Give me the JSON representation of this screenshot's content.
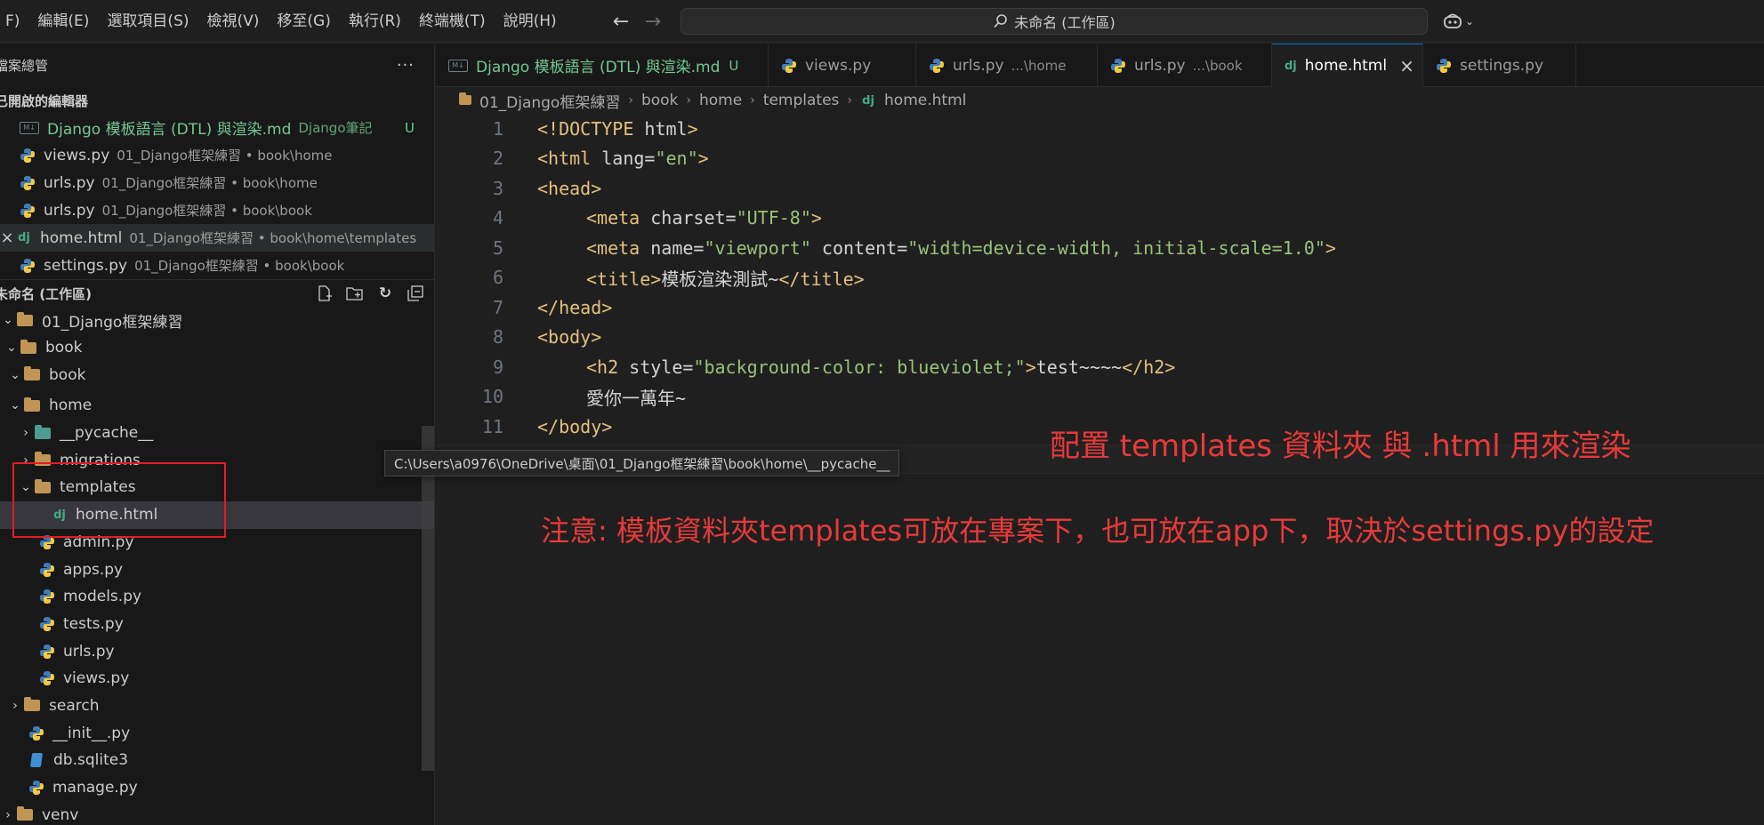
{
  "menu": {
    "items": [
      "F)",
      "編輯(E)",
      "選取項目(S)",
      "檢視(V)",
      "移至(G)",
      "執行(R)",
      "終端機(T)",
      "說明(H)"
    ]
  },
  "command_center": {
    "text": "未命名 (工作區)"
  },
  "sidebar": {
    "title": "檔案總管",
    "more_label": "···",
    "open_editors_title": "已開啟的編輯器",
    "open_editors": [
      {
        "name": "Django 模板語言 (DTL) 與渲染.md",
        "desc": "Django筆記",
        "badge": "U",
        "icon": "markdown-icon"
      },
      {
        "name": "views.py",
        "desc": "01_Django框架練習 • book\\home",
        "icon": "python-icon"
      },
      {
        "name": "urls.py",
        "desc": "01_Django框架練習 • book\\home",
        "icon": "python-icon"
      },
      {
        "name": "urls.py",
        "desc": "01_Django框架練習 • book\\book",
        "icon": "python-icon"
      },
      {
        "name": "home.html",
        "desc": "01_Django框架練習 • book\\home\\templates",
        "icon": "django-icon",
        "close": "×"
      },
      {
        "name": "settings.py",
        "desc": "01_Django框架練習 • book\\book",
        "icon": "python-icon"
      }
    ],
    "workspace_title": "未命名 (工作區)",
    "tree": [
      {
        "label": "01_Django框架練習"
      },
      {
        "label": "book"
      },
      {
        "label": "book"
      },
      {
        "label": "home"
      },
      {
        "label": "__pycache__"
      },
      {
        "label": "migrations"
      },
      {
        "label": "templates"
      },
      {
        "label": "home.html"
      },
      {
        "label": "admin.py"
      },
      {
        "label": "apps.py"
      },
      {
        "label": "models.py"
      },
      {
        "label": "tests.py"
      },
      {
        "label": "urls.py"
      },
      {
        "label": "views.py"
      },
      {
        "label": "search"
      },
      {
        "label": "__init__.py"
      },
      {
        "label": "db.sqlite3"
      },
      {
        "label": "manage.py"
      },
      {
        "label": "venv"
      }
    ],
    "tooltip": "C:\\Users\\a0976\\OneDrive\\桌面\\01_Django框架練習\\book\\home\\__pycache__"
  },
  "tabs": [
    {
      "name": "Django 模板語言 (DTL) 與渲染.md",
      "badge": "U"
    },
    {
      "name": "views.py"
    },
    {
      "name": "urls.py",
      "desc": "...\\home"
    },
    {
      "name": "urls.py",
      "desc": "...\\book"
    },
    {
      "name": "home.html",
      "close": "×"
    },
    {
      "name": "settings.py"
    }
  ],
  "breadcrumb": [
    "01_Django框架練習",
    "book",
    "home",
    "templates",
    "home.html"
  ],
  "code": {
    "line_numbers": [
      "1",
      "2",
      "3",
      "4",
      "5",
      "6",
      "7",
      "8",
      "9",
      "10",
      "11"
    ],
    "l1": {
      "open": "<!",
      "tag": "DOCTYPE",
      "attr": " html",
      "close": ">"
    },
    "l2": {
      "open": "<",
      "tag": "html",
      "attr": " lang=",
      "val": "\"en\"",
      "close": ">"
    },
    "l3": {
      "open": "<",
      "tag": "head",
      "close": ">"
    },
    "l4": {
      "open": "<",
      "tag": "meta",
      "attr": " charset=",
      "val": "\"UTF-8\"",
      "close": ">"
    },
    "l5": {
      "open": "<",
      "tag": "meta",
      "attr": " name=",
      "val": "\"viewport\"",
      "attr2": " content=",
      "val2": "\"width=device-width, initial-scale=1.0\"",
      "close": ">"
    },
    "l6": {
      "open": "<",
      "tag": "title",
      "close": ">",
      "text": "模板渲染測試~",
      "endopen": "</",
      "endtag": "title",
      "endclose": ">"
    },
    "l7": {
      "open": "</",
      "tag": "head",
      "close": ">"
    },
    "l8": {
      "open": "<",
      "tag": "body",
      "close": ">"
    },
    "l9": {
      "open": "<",
      "tag": "h2",
      "attr": " style=",
      "val": "\"background-color: blueviolet;\"",
      "close": ">",
      "text": "test~~~~",
      "endopen": "</",
      "endtag": "h2",
      "endclose": ">"
    },
    "l10": {
      "text": "愛你一萬年~"
    },
    "l11": {
      "open": "</",
      "tag": "body",
      "close": ">"
    }
  },
  "annotations": {
    "a1": "配置 templates 資料夾 與 .html 用來渲染",
    "a2": "注意: 模板資料夾templates可放在專案下，也可放在app下，取決於settings.py的設定"
  },
  "colors": {
    "annotation": "#e83a3a",
    "highlight_box": "#e51c23",
    "accent": "#0078d4",
    "untracked": "#73c991"
  }
}
